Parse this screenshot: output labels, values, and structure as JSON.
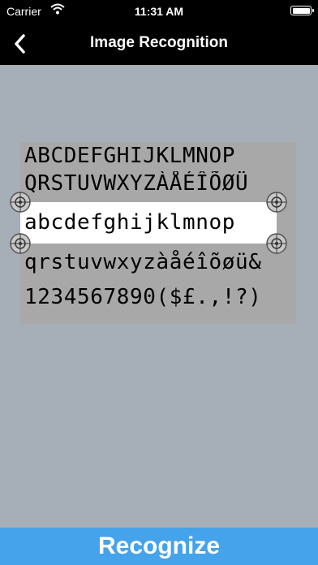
{
  "status_bar": {
    "carrier": "Carrier",
    "time": "11:31 AM"
  },
  "nav": {
    "title": "Image Recognition",
    "back_icon": "chevron-left-icon"
  },
  "document": {
    "lines": [
      "ABCDEFGHIJKLMNOP",
      "QRSTUVWXYZÀÅÉÎÕØÜ",
      "abcdefghijklmnop",
      "qrstuvwxyzàåéîõøü&",
      "1234567890($£.,!?)"
    ]
  },
  "selection": {
    "text": "abcdefghijklmnop",
    "handle_icon": "crosshair-handle-icon"
  },
  "actions": {
    "recognize_label": "Recognize"
  },
  "colors": {
    "background": "#a6aeb7",
    "bar": "#000000",
    "document": "#a8a8a8",
    "selection": "#ffffff",
    "accent": "#44a3ea"
  }
}
